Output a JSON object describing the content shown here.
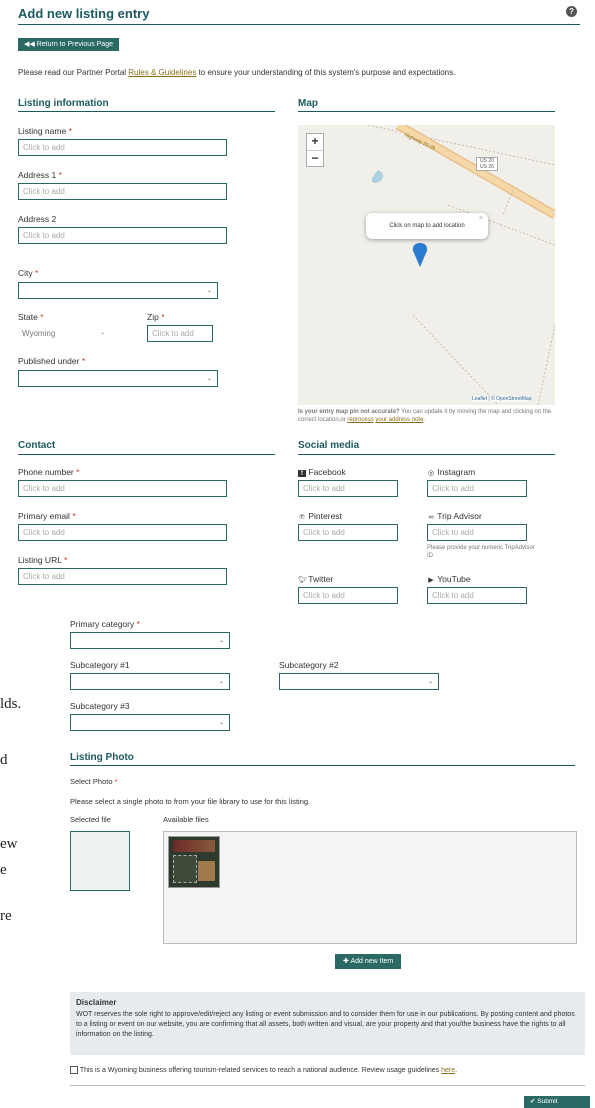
{
  "page": {
    "title": "Add new listing entry",
    "help_glyph": "?",
    "return_button": "Return to Previous Page",
    "intro_before": "Please read our Partner Portal ",
    "intro_link": "Rules & Guidelines",
    "intro_after": " to ensure your understanding of this system's purpose and expectations.",
    "required_mark": "*"
  },
  "listing_info": {
    "heading": "Listing information",
    "listing_name_label": "Listing name",
    "address1_label": "Address 1",
    "address2_label": "Address 2",
    "city_label": "City",
    "state_label": "State",
    "state_value": "Wyoming",
    "zip_label": "Zip",
    "published_label": "Published under",
    "placeholder": "Click to add"
  },
  "map": {
    "heading": "Map",
    "zoom_in": "+",
    "zoom_out": "−",
    "popup_text": "Click on map to add location",
    "popup_close": "×",
    "road_label": "Highway 20-26",
    "shield_line1": "US 20",
    "shield_line2": "US 26",
    "attribution": "Leaflet | © OpenStreetMap",
    "note_bold": "Is your entry map pin not accurate?",
    "note_text": " You can update it by moving the map and clicking on the correct location,or ",
    "note_link1": "reprocess",
    "note_mid": " ",
    "note_link2": "your address note",
    "note_end": "."
  },
  "contact": {
    "heading": "Contact",
    "phone_label": "Phone number",
    "email_label": "Primary email",
    "url_label": "Listing URL",
    "placeholder": "Click to add"
  },
  "social": {
    "heading": "Social media",
    "facebook": "Facebook",
    "instagram": "Instagram",
    "pinterest": "Pinterest",
    "tripadvisor": "Trip Advisor",
    "tripadvisor_hint": "Please provide your numeric TripAdvisor ID",
    "twitter": "Twitter",
    "youtube": "YouTube",
    "placeholder": "Click to add"
  },
  "categories": {
    "primary_label": "Primary category",
    "sub1_label": "Subcategory #1",
    "sub2_label": "Subcategory #2",
    "sub3_label": "Subcategory #3"
  },
  "photo": {
    "heading": "Listing Photo",
    "select_label": "Select Photo",
    "instruction": "Please select a single photo to from your file library to use for this listing.",
    "selected_label": "Selected file",
    "available_label": "Available files",
    "add_button": "Add new Item"
  },
  "disclaimer": {
    "title": "Disclaimer",
    "body": "WOT reserves the sole right to approve/edit/reject any listing or event submission and to consider them for use in our publications. By posting content and photos to a listing or event on our website, you are confirming that all assets, both written and visual, are your property and that you/the business have the rights to all information on the listing."
  },
  "checkbox": {
    "text": "This is a Wyoming business offering tourism-related services to reach a national audience. Review usage guidelines ",
    "link": "here",
    "end": "."
  },
  "submit": {
    "label": "Submit"
  },
  "left_fragments": [
    "lds.",
    "d",
    "ew",
    "e",
    "re"
  ],
  "colors": {
    "accent": "#1d5a5f",
    "button": "#2b6a64",
    "required": "#c0392b",
    "link": "#8a6d1a"
  }
}
